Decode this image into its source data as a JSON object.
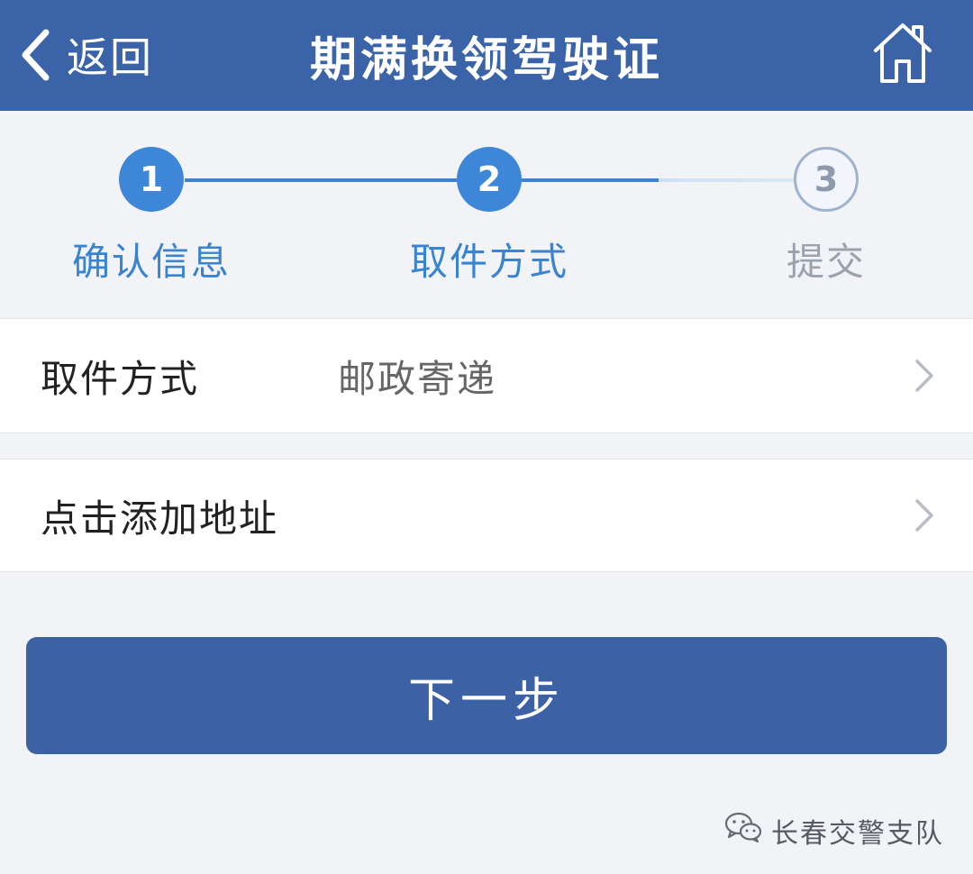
{
  "header": {
    "back_label": "返回",
    "title": "期满换领驾驶证",
    "home_icon": "home-icon"
  },
  "steps": [
    {
      "number": "1",
      "label": "确认信息",
      "state": "done"
    },
    {
      "number": "2",
      "label": "取件方式",
      "state": "current"
    },
    {
      "number": "3",
      "label": "提交",
      "state": "pending"
    }
  ],
  "pickup_row": {
    "label": "取件方式",
    "value": "邮政寄递"
  },
  "address_row": {
    "label": "点击添加地址"
  },
  "next_button": {
    "label": "下一步"
  },
  "watermark": {
    "text": "长春交警支队"
  },
  "colors": {
    "header_bg": "#3a63a8",
    "step_active": "#3e86d8",
    "button_bg": "#3c62a5",
    "page_bg": "#f2f3f7"
  }
}
